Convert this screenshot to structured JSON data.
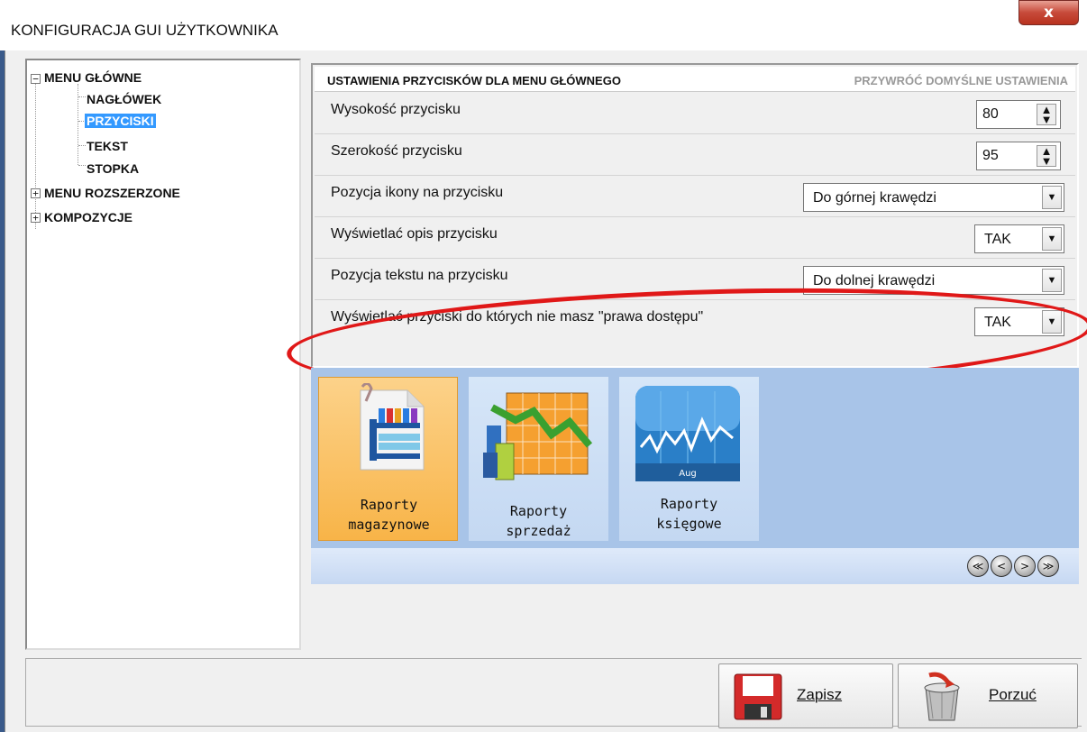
{
  "window": {
    "title": "KONFIGURACJA GUI UŻYTKOWNIKA",
    "close_glyph": "x"
  },
  "tree": {
    "items": [
      {
        "label": "MENU GŁÓWNE",
        "expander": "−"
      },
      {
        "label": "NAGŁÓWEK"
      },
      {
        "label": "PRZYCISKI",
        "selected": true
      },
      {
        "label": "TEKST"
      },
      {
        "label": "STOPKA"
      },
      {
        "label": "MENU ROZSZERZONE",
        "expander": "+"
      },
      {
        "label": "KOMPOZYCJE",
        "expander": "+"
      }
    ]
  },
  "settings": {
    "title": "USTAWIENIA PRZYCISKÓW DLA MENU GŁÓWNEGO",
    "reset_label": "PRZYWRÓĆ DOMYŚLNE USTAWIENIA",
    "rows": [
      {
        "label": "Wysokość przycisku",
        "value": "80"
      },
      {
        "label": "Szerokość przycisku",
        "value": "95"
      },
      {
        "label": "Pozycja ikony na przycisku",
        "value": "Do górnej krawędzi"
      },
      {
        "label": "Wyświetlać opis przycisku",
        "value": "TAK"
      },
      {
        "label": "Pozycja tekstu na przycisku",
        "value": "Do dolnej krawędzi"
      },
      {
        "label": "Wyświetlać przyciski do których nie masz  \"prawa dostępu\"",
        "value": "TAK"
      }
    ]
  },
  "preview": {
    "tiles": [
      {
        "line1": "Raporty",
        "line2": "magazynowe",
        "icon": "warehouse-report-icon"
      },
      {
        "line1": "Raporty",
        "line2": "sprzedaż",
        "icon": "sales-report-icon"
      },
      {
        "line1": "Raporty",
        "line2": "księgowe",
        "icon": "accounting-report-icon",
        "chart_month": "Aug"
      }
    ],
    "nav": {
      "first": "≪",
      "prev": "<",
      "next": ">",
      "last": "≫"
    }
  },
  "footer": {
    "save_label": "Zapisz",
    "discard_label": "Porzuć"
  },
  "colors": {
    "selection": "#3399ff",
    "preview_bg": "#a8c4e8",
    "highlight": "#e01818"
  }
}
